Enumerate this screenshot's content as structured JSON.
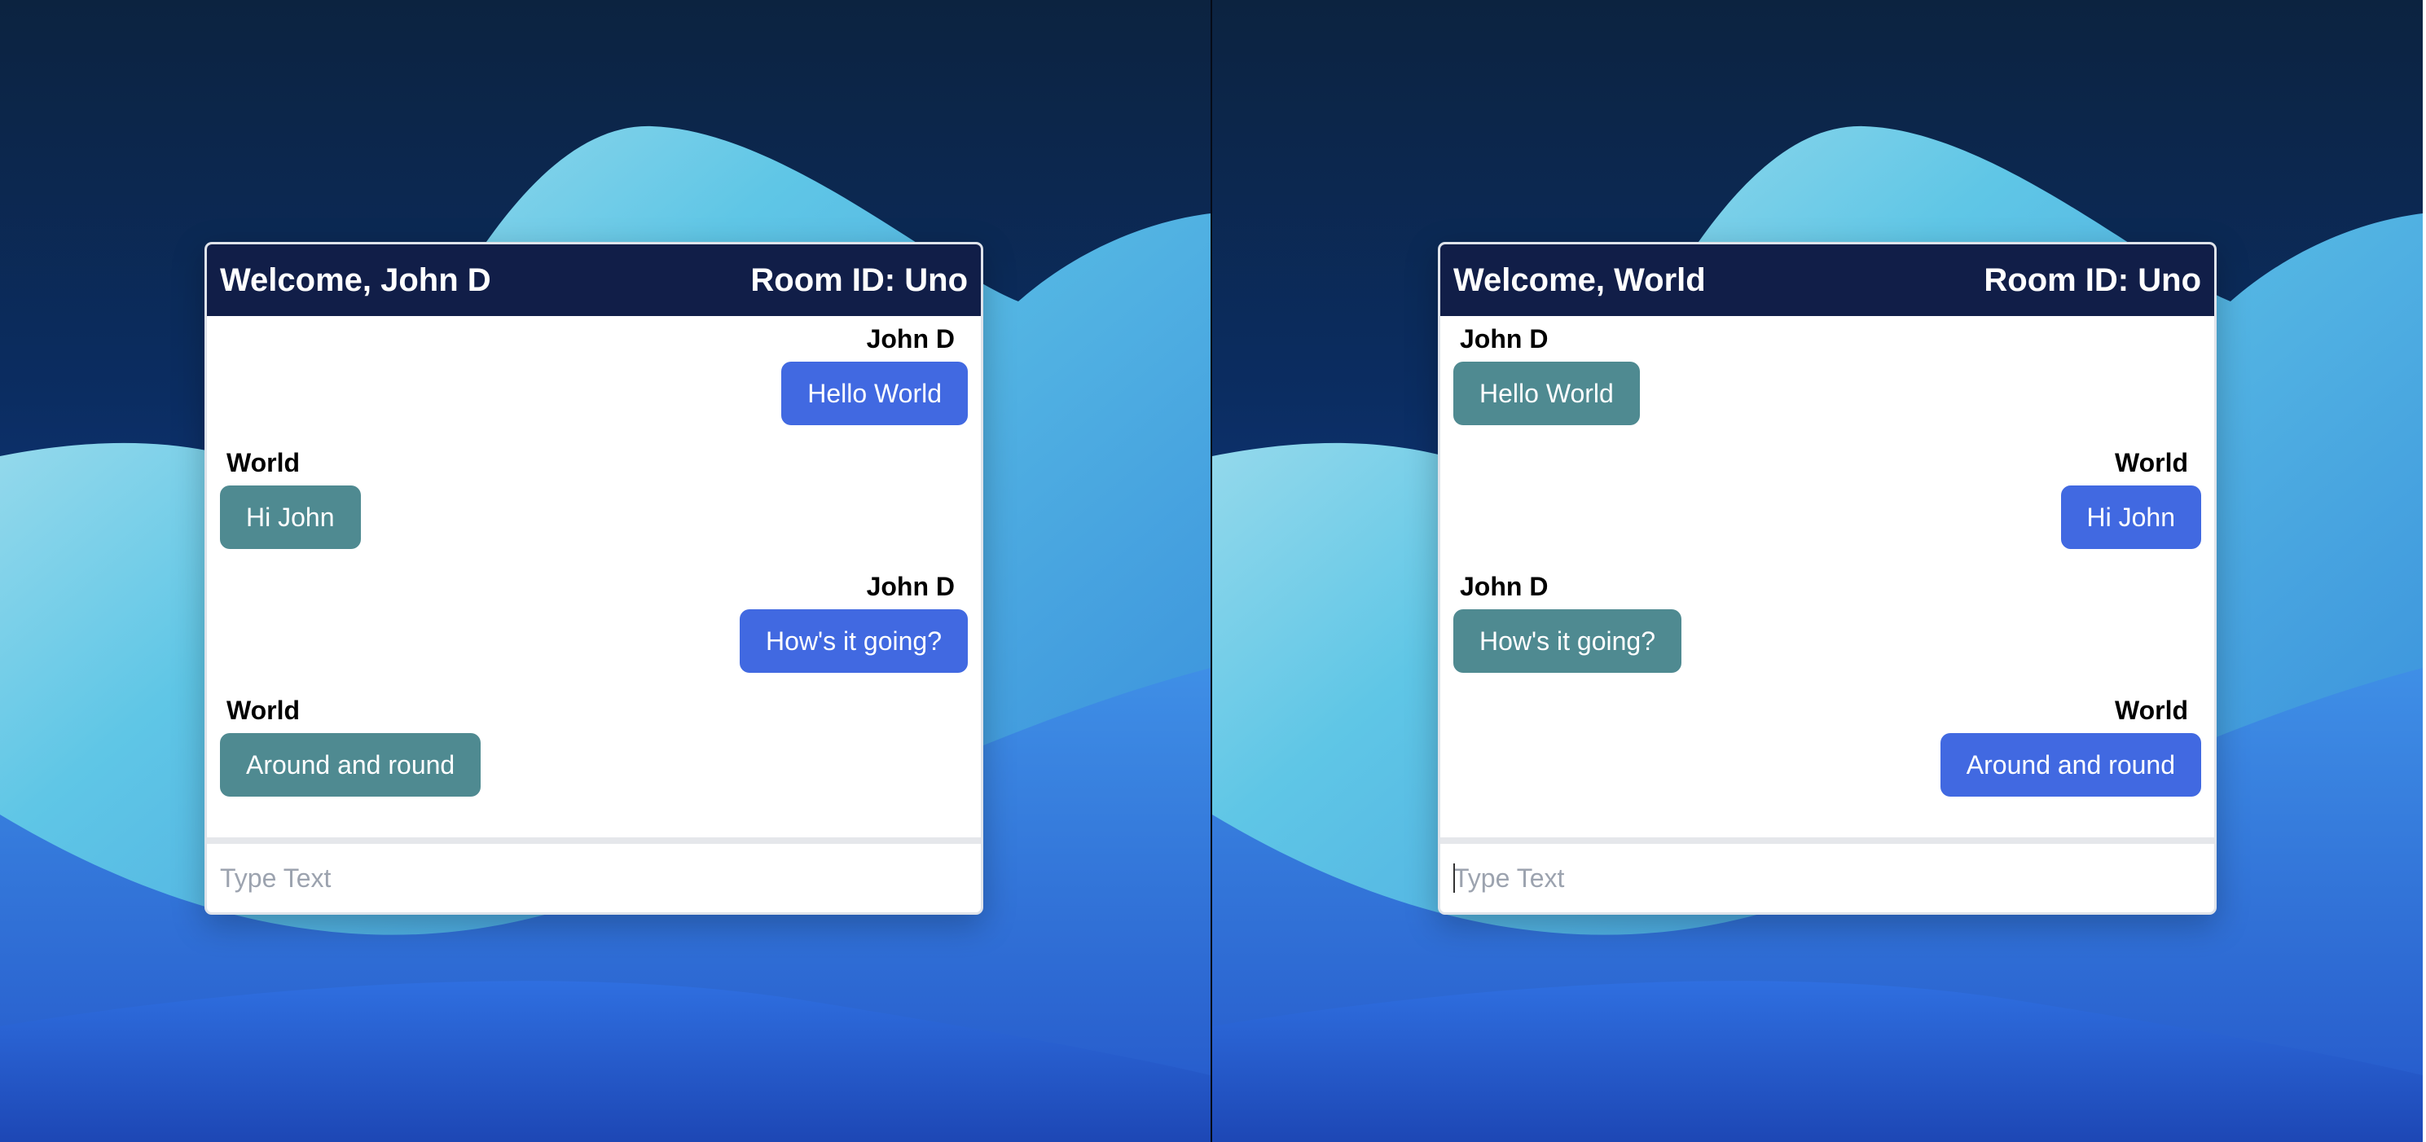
{
  "colors": {
    "header_bg": "#111e48",
    "own_bubble": "#4169e1",
    "other_bubble": "#4f8a91"
  },
  "left_window": {
    "welcome": "Welcome, John D",
    "room": "Room ID: Uno",
    "messages": [
      {
        "sender": "John D",
        "text": "Hello World",
        "side": "right"
      },
      {
        "sender": "World",
        "text": "Hi John",
        "side": "left"
      },
      {
        "sender": "John D",
        "text": "How's it going?",
        "side": "right"
      },
      {
        "sender": "World",
        "text": "Around and round",
        "side": "left"
      }
    ],
    "input_placeholder": "Type Text"
  },
  "right_window": {
    "welcome": "Welcome, World",
    "room": "Room ID: Uno",
    "messages": [
      {
        "sender": "John D",
        "text": "Hello World",
        "side": "left"
      },
      {
        "sender": "World",
        "text": "Hi John",
        "side": "right"
      },
      {
        "sender": "John D",
        "text": "How's it going?",
        "side": "left"
      },
      {
        "sender": "World",
        "text": "Around and round",
        "side": "right"
      }
    ],
    "input_placeholder": "Type Text"
  }
}
